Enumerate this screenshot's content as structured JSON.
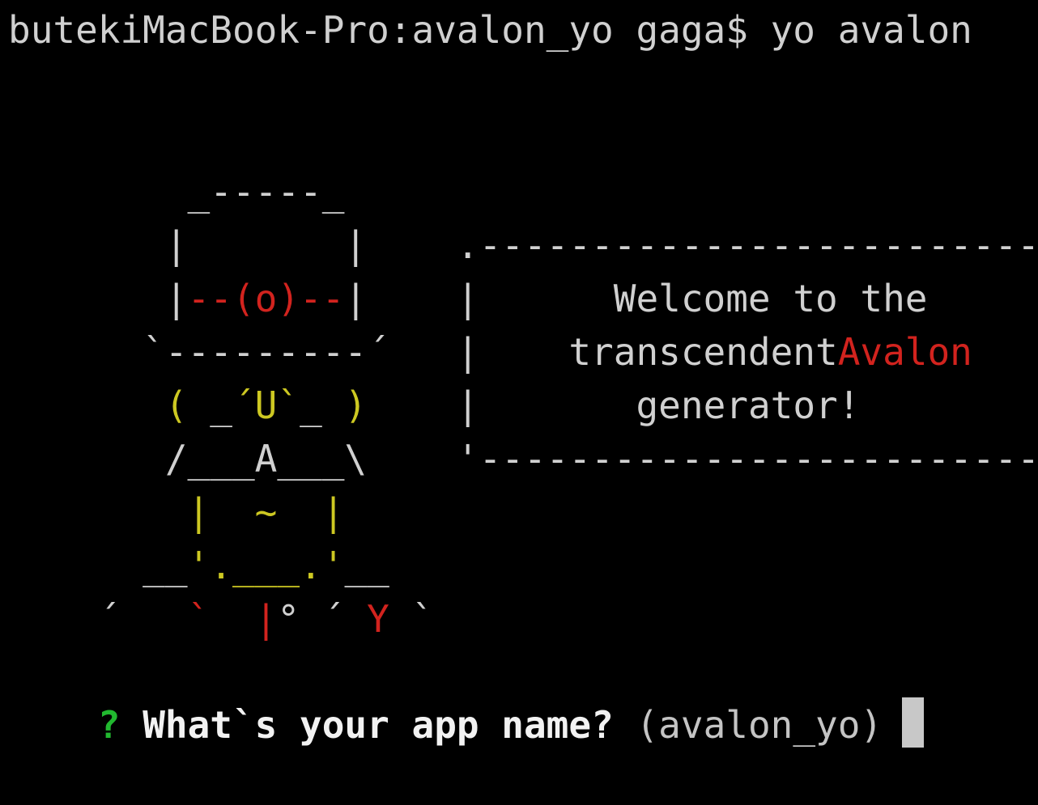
{
  "terminal": {
    "prompt_line": "butekiMacBook-Pro:avalon_yo gaga$ yo avalon",
    "art": [
      [
        {
          "text": "    _-----_",
          "color": "white"
        }
      ],
      [
        {
          "text": "   |       |    .--------------------------.",
          "color": "white"
        }
      ],
      [
        {
          "text": "   |",
          "color": "white"
        },
        {
          "text": "--(o)--",
          "color": "red"
        },
        {
          "text": "|    |      Welcome to the      |",
          "color": "white"
        }
      ],
      [
        {
          "text": "  `---------´   |    transcendent",
          "color": "white"
        },
        {
          "text": "Avalon",
          "color": "red"
        },
        {
          "text": "    |",
          "color": "white"
        }
      ],
      [
        {
          "text": "   ( ",
          "color": "yellow"
        },
        {
          "text": "_",
          "color": "white"
        },
        {
          "text": "´U`",
          "color": "yellow"
        },
        {
          "text": "_",
          "color": "white"
        },
        {
          "text": " )",
          "color": "yellow"
        },
        {
          "text": "    |       generator!         |",
          "color": "white"
        }
      ],
      [
        {
          "text": "   /___A___\\    '--------------------------'",
          "color": "white"
        }
      ],
      [
        {
          "text": "    |  ~  |",
          "color": "yellow"
        }
      ],
      [
        {
          "text": "  __",
          "color": "white"
        },
        {
          "text": "'.___.'",
          "color": "yellow"
        },
        {
          "text": "__",
          "color": "white"
        }
      ],
      [
        {
          "text": "´   ",
          "color": "white"
        },
        {
          "text": "`",
          "color": "red"
        },
        {
          "text": "  ",
          "color": "white"
        },
        {
          "text": "|",
          "color": "red"
        },
        {
          "text": "° ´ ",
          "color": "white"
        },
        {
          "text": "Y",
          "color": "red"
        },
        {
          "text": " `",
          "color": "white"
        }
      ]
    ],
    "question": {
      "marker": "?",
      "text": "What`s your app name?",
      "default_value": "(avalon_yo)"
    },
    "colors": {
      "background": "#000000",
      "text": "#d0d0d0",
      "red": "#d2231e",
      "yellow": "#cdc822",
      "green": "#21b82f",
      "cursor": "#c8c8c8"
    }
  }
}
